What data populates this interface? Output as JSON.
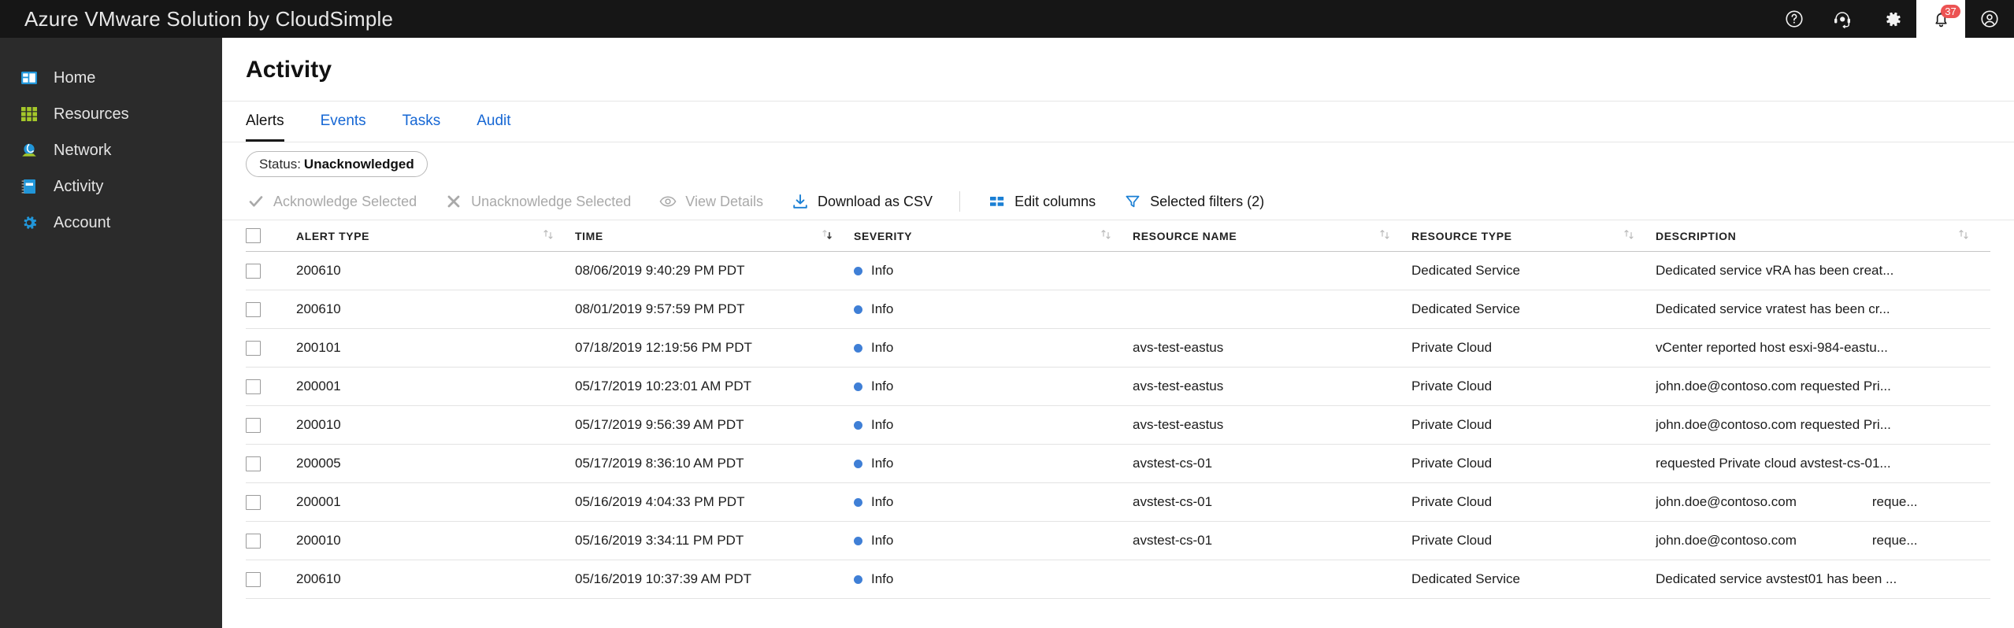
{
  "topbar": {
    "brand": "Azure VMware Solution by CloudSimple",
    "icons": [
      {
        "name": "help-icon",
        "label": "Help"
      },
      {
        "name": "support-icon",
        "label": "Support"
      },
      {
        "name": "gear-icon",
        "label": "Settings"
      },
      {
        "name": "bell-icon",
        "label": "Notifications",
        "badge": "37"
      },
      {
        "name": "account-icon",
        "label": "Account"
      }
    ]
  },
  "sidebar": {
    "items": [
      {
        "label": "Home",
        "icon": "dashboard-icon"
      },
      {
        "label": "Resources",
        "icon": "grid-icon"
      },
      {
        "label": "Network",
        "icon": "network-globe-icon"
      },
      {
        "label": "Activity",
        "icon": "notebook-icon"
      },
      {
        "label": "Account",
        "icon": "gear-icon"
      }
    ]
  },
  "page": {
    "title": "Activity",
    "tabs": [
      {
        "label": "Alerts",
        "active": true
      },
      {
        "label": "Events",
        "active": false
      },
      {
        "label": "Tasks",
        "active": false
      },
      {
        "label": "Audit",
        "active": false
      }
    ],
    "filter_chip": {
      "prefix": "Status:",
      "value": "Unacknowledged"
    }
  },
  "toolbar": {
    "acknowledge_label": "Acknowledge Selected",
    "unacknowledge_label": "Unacknowledge Selected",
    "view_details_label": "View Details",
    "download_csv_label": "Download as CSV",
    "edit_columns_label": "Edit columns",
    "selected_filters_label": "Selected filters (2)"
  },
  "table": {
    "columns": [
      {
        "key": "alert_type",
        "label": "ALERT TYPE",
        "sorted": false
      },
      {
        "key": "time",
        "label": "TIME",
        "sorted": true,
        "direction": "desc"
      },
      {
        "key": "severity",
        "label": "SEVERITY",
        "sorted": false
      },
      {
        "key": "resource_name",
        "label": "RESOURCE NAME",
        "sorted": false
      },
      {
        "key": "resource_type",
        "label": "RESOURCE TYPE",
        "sorted": false
      },
      {
        "key": "description",
        "label": "DESCRIPTION",
        "sorted": false
      }
    ],
    "rows": [
      {
        "alert_type": "200610",
        "time": "08/06/2019 9:40:29 PM PDT",
        "severity": "Info",
        "resource_name": "",
        "resource_type": "Dedicated Service",
        "description": "Dedicated service vRA has been creat..."
      },
      {
        "alert_type": "200610",
        "time": "08/01/2019 9:57:59 PM PDT",
        "severity": "Info",
        "resource_name": "",
        "resource_type": "Dedicated Service",
        "description": "Dedicated service vratest has been cr..."
      },
      {
        "alert_type": "200101",
        "time": "07/18/2019 12:19:56 PM PDT",
        "severity": "Info",
        "resource_name": "avs-test-eastus",
        "resource_type": "Private Cloud",
        "description": "vCenter reported host esxi-984-eastu..."
      },
      {
        "alert_type": "200001",
        "time": "05/17/2019 10:23:01 AM PDT",
        "severity": "Info",
        "resource_name": "avs-test-eastus",
        "resource_type": "Private Cloud",
        "description": "john.doe@contoso.com requested Pri..."
      },
      {
        "alert_type": "200010",
        "time": "05/17/2019 9:56:39 AM PDT",
        "severity": "Info",
        "resource_name": "avs-test-eastus",
        "resource_type": "Private Cloud",
        "description": "john.doe@contoso.com requested Pri..."
      },
      {
        "alert_type": "200005",
        "time": "05/17/2019 8:36:10 AM PDT",
        "severity": "Info",
        "resource_name": "avstest-cs-01",
        "resource_type": "Private Cloud",
        "description": "requested Private cloud avstest-cs-01..."
      },
      {
        "alert_type": "200001",
        "time": "05/16/2019 4:04:33 PM PDT",
        "severity": "Info",
        "resource_name": "avstest-cs-01",
        "resource_type": "Private Cloud",
        "description_part1": "john.doe@contoso.com",
        "description_part2": "reque..."
      },
      {
        "alert_type": "200010",
        "time": "05/16/2019 3:34:11 PM PDT",
        "severity": "Info",
        "resource_name": "avstest-cs-01",
        "resource_type": "Private Cloud",
        "description_part1": "john.doe@contoso.com",
        "description_part2": "reque..."
      },
      {
        "alert_type": "200610",
        "time": "05/16/2019 10:37:39 AM PDT",
        "severity": "Info",
        "resource_name": "",
        "resource_type": "Dedicated Service",
        "description": "Dedicated service avstest01 has been ..."
      }
    ]
  },
  "colors": {
    "topbar_bg": "#161616",
    "sidebar_bg": "#2b2b2b",
    "link_blue": "#1667d4",
    "icon_blue": "#1a7fd4",
    "accent_green": "#a4c72a",
    "badge_red": "#ec5353",
    "severity_info": "#3f7fd6"
  }
}
